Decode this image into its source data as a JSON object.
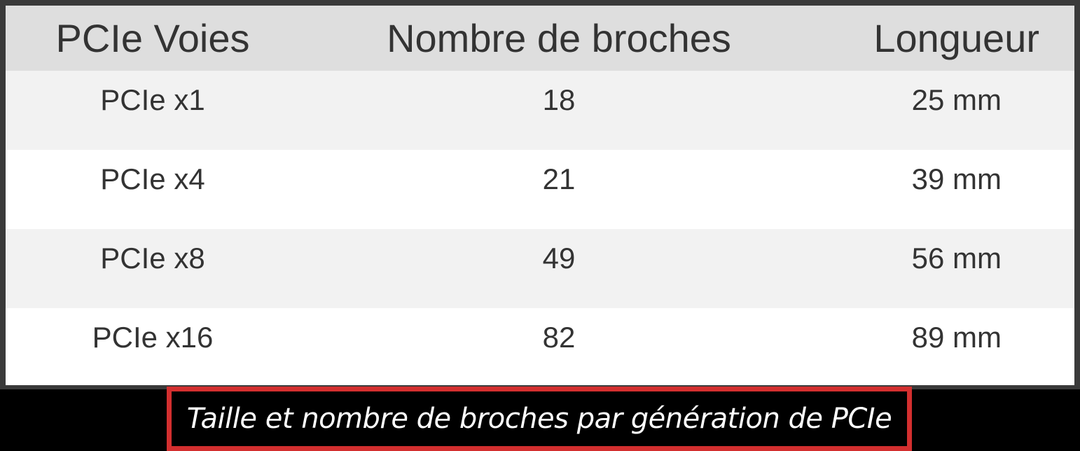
{
  "table": {
    "headers": [
      "PCIe Voies",
      "Nombre de broches",
      "Longueur"
    ],
    "rows": [
      [
        "PCIe x1",
        "18",
        "25 mm"
      ],
      [
        "PCIe x4",
        "21",
        "39 mm"
      ],
      [
        "PCIe x8",
        "49",
        "56 mm"
      ],
      [
        "PCIe x16",
        "82",
        "89 mm"
      ]
    ]
  },
  "caption": "Taille et nombre de broches par génération de PCIe",
  "colors": {
    "header_bg": "#dedede",
    "row_odd_bg": "#f2f2f2",
    "row_even_bg": "#ffffff",
    "frame_border": "#3a3a3a",
    "caption_border": "#d32f2f",
    "caption_bg": "#000000",
    "text": "#333333"
  }
}
